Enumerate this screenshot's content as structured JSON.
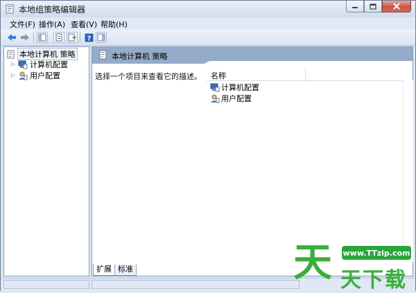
{
  "window": {
    "title": "本地组策略编辑器"
  },
  "menu": {
    "items": [
      {
        "label": "文件(F)"
      },
      {
        "label": "操作(A)"
      },
      {
        "label": "查看(V)"
      },
      {
        "label": "帮助(H)"
      }
    ]
  },
  "toolbar": {
    "icons": [
      "back-arrow-icon",
      "forward-arrow-icon",
      "show-hide-tree-icon",
      "properties-icon",
      "export-list-icon",
      "help-icon",
      "show-hide-action-pane-icon"
    ]
  },
  "tree": {
    "root": {
      "label": "本地计算机 策略"
    },
    "children": [
      {
        "label": "计算机配置"
      },
      {
        "label": "用户配置"
      }
    ]
  },
  "content": {
    "header_title": "本地计算机 策略",
    "description": "选择一个项目来查看它的描述。",
    "column_name": "名称",
    "rows": [
      {
        "label": "计算机配置"
      },
      {
        "label": "用户配置"
      }
    ]
  },
  "tabs": [
    {
      "label": "扩展"
    },
    {
      "label": "标准"
    }
  ],
  "watermark": {
    "url": "www.TTzip.com",
    "big_char": "天",
    "small_text": "天下载"
  },
  "colors": {
    "header_bg": "#95abca",
    "watermark_green": "#3aae3a"
  }
}
